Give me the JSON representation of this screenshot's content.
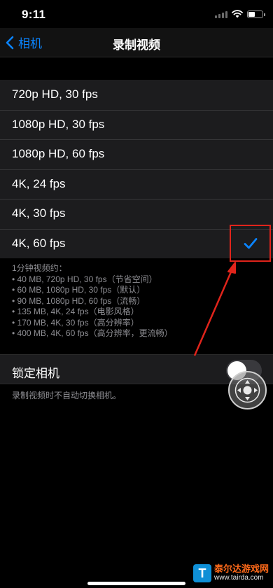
{
  "status_bar": {
    "time": "9:11"
  },
  "nav": {
    "back_label": "相机",
    "title": "录制视频"
  },
  "options": [
    {
      "label": "720p HD, 30 fps",
      "selected": false
    },
    {
      "label": "1080p HD, 30 fps",
      "selected": false
    },
    {
      "label": "1080p HD, 60 fps",
      "selected": false
    },
    {
      "label": "4K, 24 fps",
      "selected": false
    },
    {
      "label": "4K, 30 fps",
      "selected": false
    },
    {
      "label": "4K, 60 fps",
      "selected": true
    }
  ],
  "footer_text": "1分钟视频约：\n• 40 MB, 720p HD, 30 fps（节省空间）\n• 60 MB, 1080p HD, 30 fps（默认）\n• 90 MB, 1080p HD, 60 fps（流畅）\n• 135 MB, 4K, 24 fps（电影风格）\n• 170 MB, 4K, 30 fps（高分辨率）\n• 400 MB, 4K, 60 fps（高分辨率，更流畅）",
  "lock_camera": {
    "label": "锁定相机",
    "enabled": false
  },
  "lock_note": "录制视频时不自动切换相机。",
  "watermark": {
    "name": "泰尔达游戏网",
    "url": "www.tairda.com",
    "logo_letter": "T"
  },
  "colors": {
    "accent": "#0a84ff",
    "annotation": "#e0241b",
    "background": "#000000",
    "cell": "#1c1c1e"
  }
}
